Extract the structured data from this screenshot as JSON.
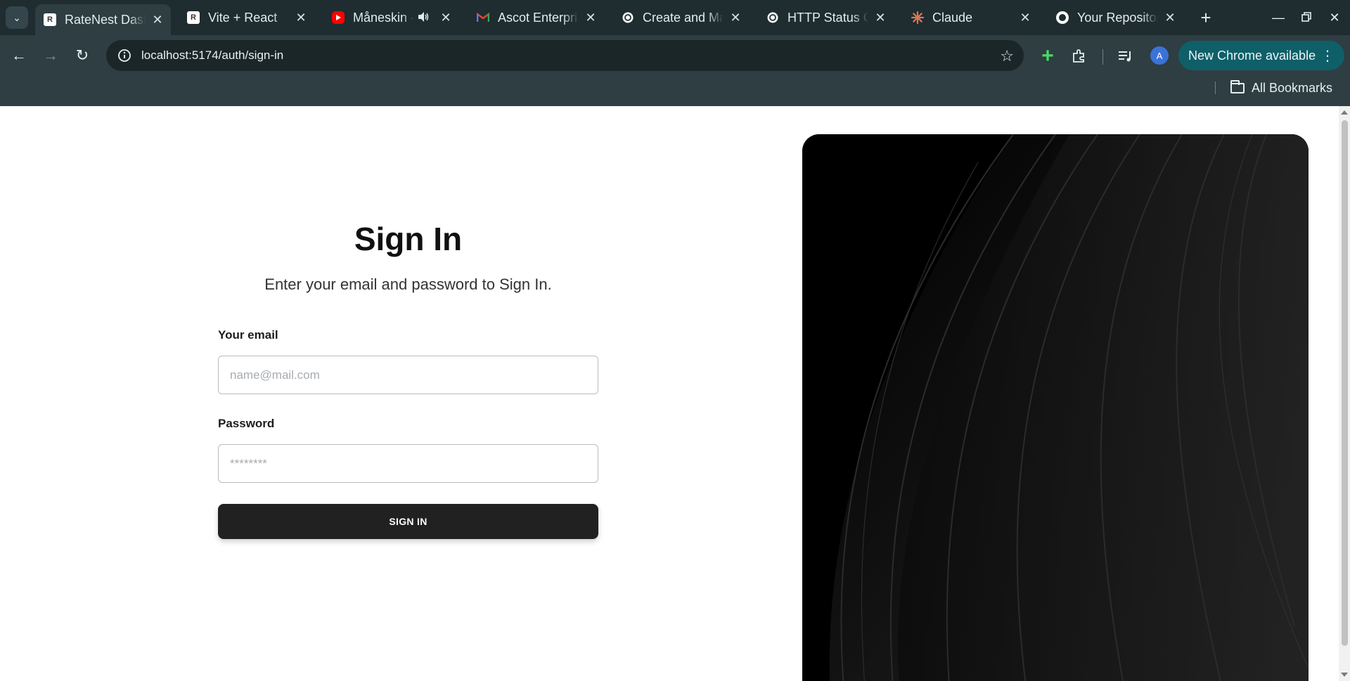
{
  "browser": {
    "tabs": [
      {
        "title": "RateNest Dashboard",
        "favicon": "ratenest-favicon",
        "active": true
      },
      {
        "title": "Vite + React",
        "favicon": "ratenest-favicon",
        "active": false
      },
      {
        "title": "Måneskin - ",
        "favicon": "youtube-favicon",
        "active": false,
        "audio": true
      },
      {
        "title": "Ascot Enterprise",
        "favicon": "gmail-favicon",
        "active": false
      },
      {
        "title": "Create and Manage",
        "favicon": "openai-favicon",
        "active": false
      },
      {
        "title": "HTTP Status Codes",
        "favicon": "openai-favicon",
        "active": false
      },
      {
        "title": "Claude",
        "favicon": "claude-favicon",
        "active": false
      },
      {
        "title": "Your Repositories",
        "favicon": "github-favicon",
        "active": false
      }
    ],
    "url": "localhost:5174/auth/sign-in",
    "profile_initial": "A",
    "update_label": "New Chrome available",
    "bookmarks_label": "All Bookmarks",
    "colors": {
      "chrome": "#2e3e42",
      "tabstrip": "#1f2c30",
      "update_button": "#0f5f69"
    }
  },
  "page": {
    "title": "Sign In",
    "subtitle": "Enter your email and password to Sign In.",
    "email_label": "Your email",
    "email_placeholder": "name@mail.com",
    "email_value": "",
    "password_label": "Password",
    "password_placeholder": "********",
    "password_value": "",
    "submit_label": "SIGN IN",
    "colors": {
      "button": "#212121",
      "hero": "#000000"
    }
  }
}
